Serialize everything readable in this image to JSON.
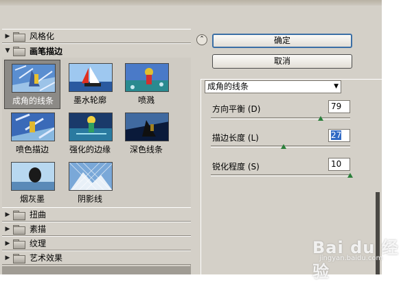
{
  "categories_top": [
    {
      "label": "风格化",
      "expanded": false
    },
    {
      "label": "画笔描边",
      "expanded": true
    }
  ],
  "thumbnails": [
    {
      "label": "成角的线条",
      "selected": true
    },
    {
      "label": "墨水轮廓",
      "selected": false
    },
    {
      "label": "喷溅",
      "selected": false
    },
    {
      "label": "喷色描边",
      "selected": false
    },
    {
      "label": "强化的边缘",
      "selected": false
    },
    {
      "label": "深色线条",
      "selected": false
    },
    {
      "label": "烟灰墨",
      "selected": false
    },
    {
      "label": "阴影线",
      "selected": false
    }
  ],
  "categories_bottom": [
    {
      "label": "扭曲"
    },
    {
      "label": "素描"
    },
    {
      "label": "纹理"
    },
    {
      "label": "艺术效果"
    }
  ],
  "buttons": {
    "ok": "确定",
    "cancel": "取消",
    "collapse_icon": "⌃"
  },
  "filter_select": {
    "value": "成角的线条",
    "arrow": "▼"
  },
  "params": [
    {
      "label": "方向平衡 (D)",
      "value": "79",
      "fraction": 0.79
    },
    {
      "label": "描边长度 (L)",
      "value": "27",
      "fraction": 0.52
    },
    {
      "label": "锐化程度 (S)",
      "value": "10",
      "fraction": 1.0
    }
  ],
  "watermark": {
    "main": "Bai du 经验",
    "sub": "jingyan.baidu.com"
  },
  "colors": {
    "dialog_bg": "#d4d0c8",
    "selection": "#316ac5",
    "slider_thumb": "#2a7f3a"
  }
}
